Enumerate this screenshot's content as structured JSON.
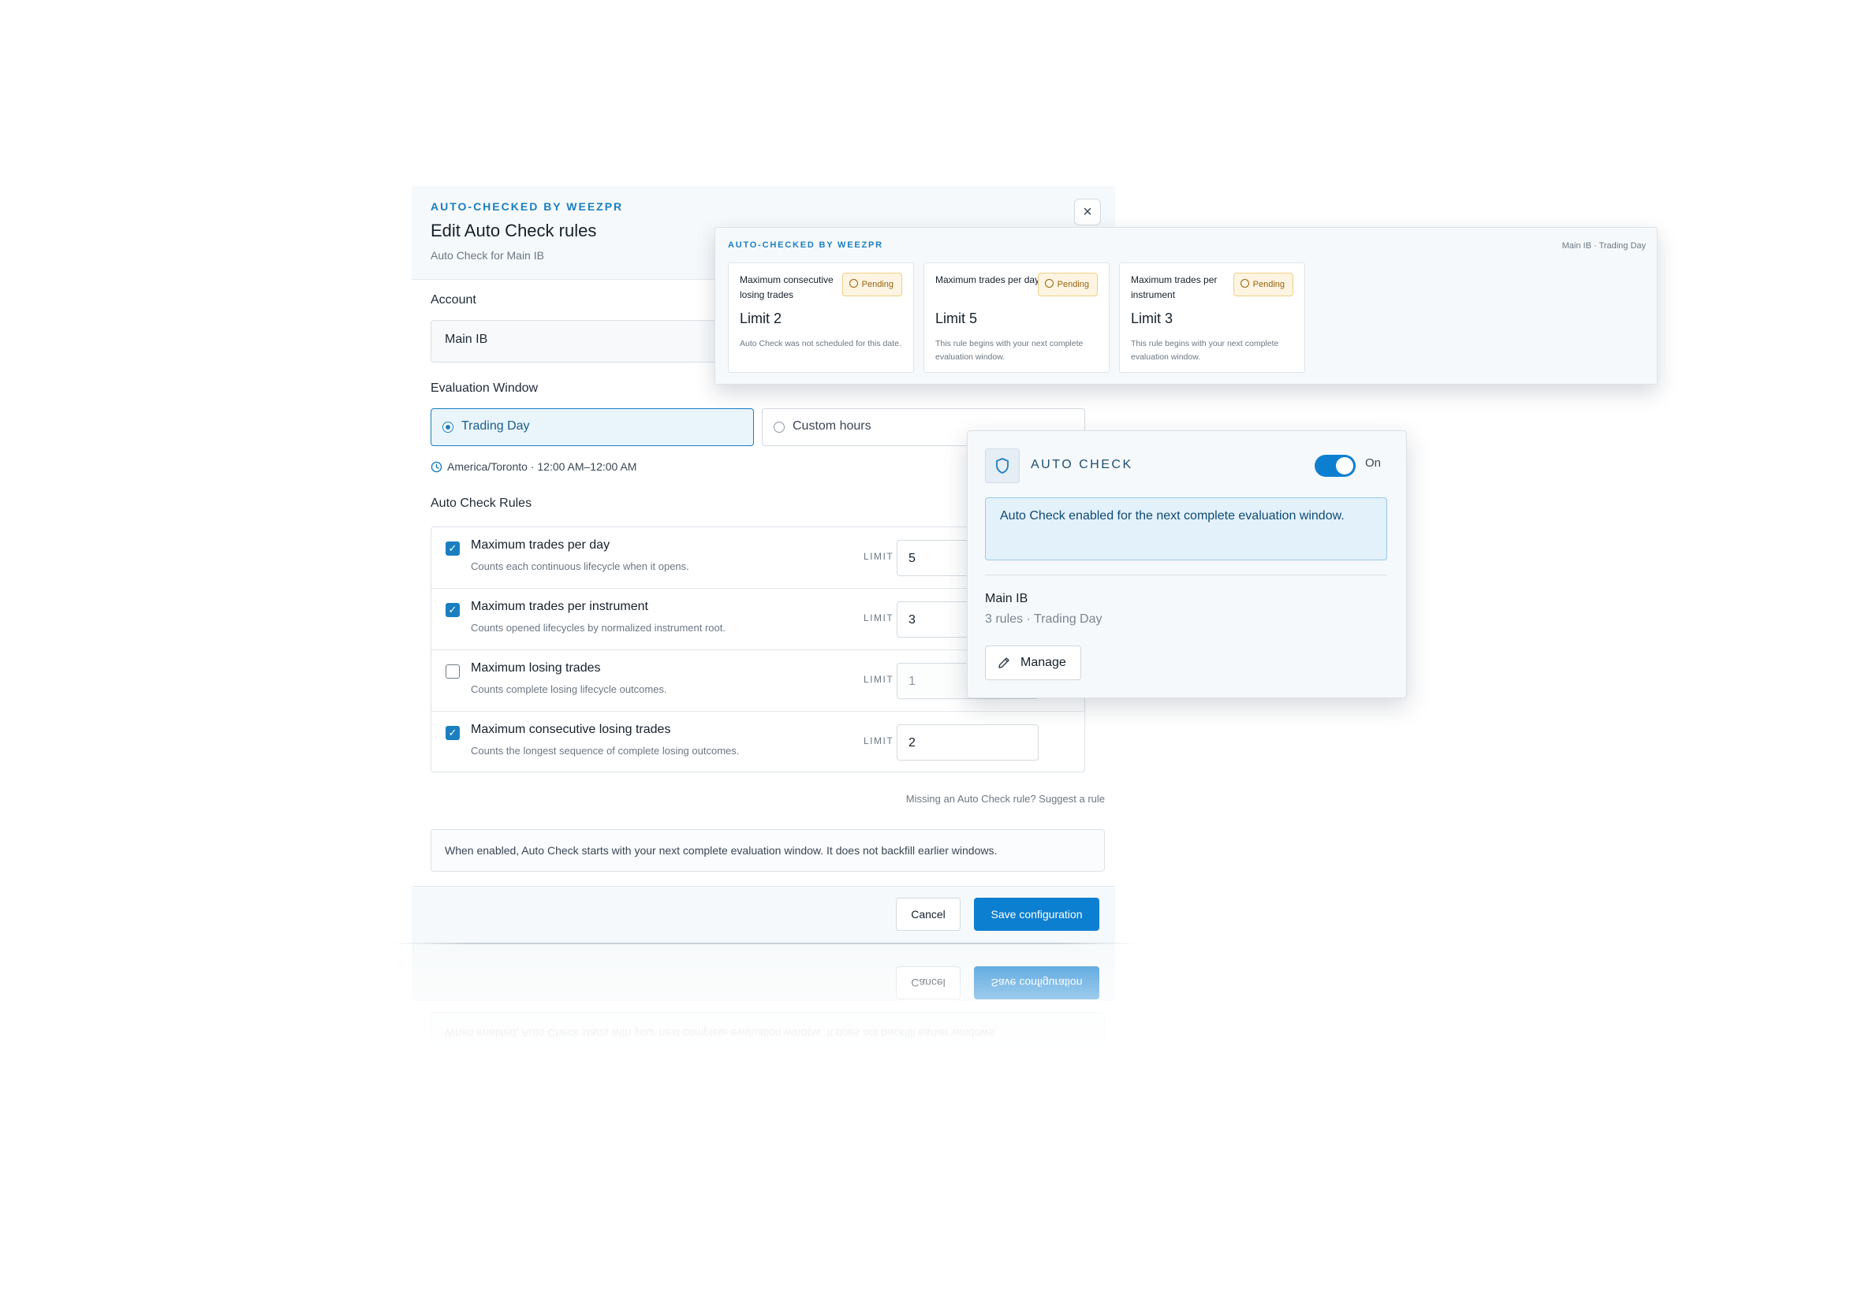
{
  "modal": {
    "eyebrow": "AUTO-CHECKED BY WEEZPR",
    "title": "Edit Auto Check rules",
    "subtitle": "Auto Check for Main IB",
    "close_icon": "×",
    "account_label": "Account",
    "account_value": "Main IB",
    "window_label": "Evaluation Window",
    "window_options": [
      {
        "label": "Trading Day",
        "selected": true
      },
      {
        "label": "Custom hours",
        "selected": false
      }
    ],
    "timezone_text": "America/Toronto · 12:00 AM–12:00 AM",
    "rules_label": "Auto Check Rules",
    "limit_label": "LIMIT",
    "rules": [
      {
        "title": "Maximum trades per day",
        "desc": "Counts each continuous lifecycle when it opens.",
        "checked": true,
        "limit": "5"
      },
      {
        "title": "Maximum trades per instrument",
        "desc": "Counts opened lifecycles by normalized instrument root.",
        "checked": true,
        "limit": "3"
      },
      {
        "title": "Maximum losing trades",
        "desc": "Counts complete losing lifecycle outcomes.",
        "checked": false,
        "limit": "1"
      },
      {
        "title": "Maximum consecutive losing trades",
        "desc": "Counts the longest sequence of complete losing outcomes.",
        "checked": true,
        "limit": "2"
      }
    ],
    "suggest_text": "Missing an Auto Check rule? Suggest a rule",
    "note": "When enabled, Auto Check starts with your next complete evaluation window. It does not backfill earlier windows.",
    "cancel_label": "Cancel",
    "save_label": "Save configuration"
  },
  "summary": {
    "eyebrow": "AUTO-CHECKED BY WEEZPR",
    "context": "Main IB · Trading Day",
    "cards": [
      {
        "title": "Maximum consecutive losing trades",
        "status": "Pending",
        "limit": "Limit 2",
        "desc": "Auto Check was not scheduled for this date."
      },
      {
        "title": "Maximum trades per day",
        "status": "Pending",
        "limit": "Limit 5",
        "desc": "This rule begins with your next complete evaluation window."
      },
      {
        "title": "Maximum trades per instrument",
        "status": "Pending",
        "limit": "Limit 3",
        "desc": "This rule begins with your next complete evaluation window."
      }
    ]
  },
  "auto_check": {
    "title": "AUTO CHECK",
    "toggle_label": "On",
    "toggle_on": true,
    "banner": "Auto Check enabled for the next complete evaluation window.",
    "account": "Main IB",
    "meta": "3 rules · Trading Day",
    "manage_label": "Manage"
  },
  "icons": {
    "close": "close-icon",
    "clock": "clock-icon",
    "shield": "shield-icon",
    "pencil": "pencil-icon",
    "check": "check-icon"
  },
  "colors": {
    "accent": "#0d7fd0",
    "eyebrow": "#1a7fc0",
    "pending_bg": "#fdf4e1",
    "pending_text": "#9a6411",
    "banner_bg": "#e3f1fb"
  }
}
